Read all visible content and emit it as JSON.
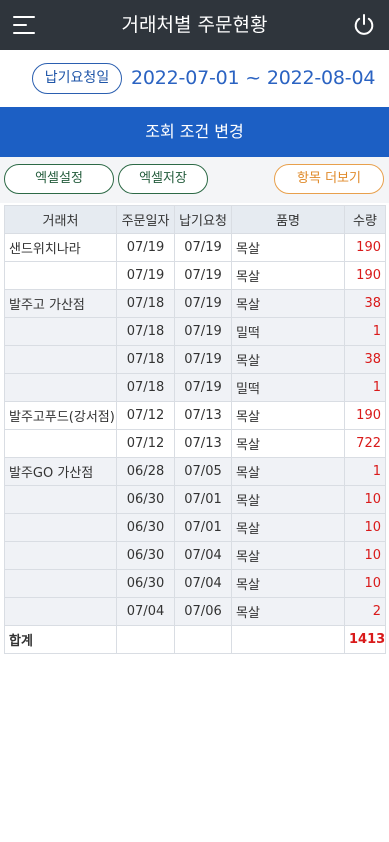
{
  "header": {
    "title": "거래처별 주문현황",
    "menu_icon": "hamburger-menu-icon",
    "power_icon": "power-icon"
  },
  "date_filter": {
    "badge_label": "납기요청일",
    "range": "2022-07-01 ~ 2022-08-04"
  },
  "search_condition_label": "조회 조건 변경",
  "buttons": {
    "excel_settings": "엑셀설정",
    "excel_save": "엑셀저장",
    "more_columns": "항목 더보기"
  },
  "table": {
    "columns": [
      "거래처",
      "주문일자",
      "납기요청",
      "품명",
      "수량"
    ],
    "rows": [
      {
        "customer": "샌드위치나라",
        "order_date": "07/19",
        "due_date": "07/19",
        "item": "목살",
        "qty": "190"
      },
      {
        "customer": "",
        "order_date": "07/19",
        "due_date": "07/19",
        "item": "목살",
        "qty": "190"
      },
      {
        "customer": "발주고 가산점",
        "order_date": "07/18",
        "due_date": "07/19",
        "item": "목살",
        "qty": "38"
      },
      {
        "customer": "",
        "order_date": "07/18",
        "due_date": "07/19",
        "item": "밀떡",
        "qty": "1"
      },
      {
        "customer": "",
        "order_date": "07/18",
        "due_date": "07/19",
        "item": "목살",
        "qty": "38"
      },
      {
        "customer": "",
        "order_date": "07/18",
        "due_date": "07/19",
        "item": "밀떡",
        "qty": "1"
      },
      {
        "customer": "발주고푸드(강서점)",
        "order_date": "07/12",
        "due_date": "07/13",
        "item": "목살",
        "qty": "190"
      },
      {
        "customer": "",
        "order_date": "07/12",
        "due_date": "07/13",
        "item": "목살",
        "qty": "722"
      },
      {
        "customer": "발주GO 가산점",
        "order_date": "06/28",
        "due_date": "07/05",
        "item": "목살",
        "qty": "1"
      },
      {
        "customer": "",
        "order_date": "06/30",
        "due_date": "07/01",
        "item": "목살",
        "qty": "10"
      },
      {
        "customer": "",
        "order_date": "06/30",
        "due_date": "07/01",
        "item": "목살",
        "qty": "10"
      },
      {
        "customer": "",
        "order_date": "06/30",
        "due_date": "07/04",
        "item": "목살",
        "qty": "10"
      },
      {
        "customer": "",
        "order_date": "06/30",
        "due_date": "07/04",
        "item": "목살",
        "qty": "10"
      },
      {
        "customer": "",
        "order_date": "07/04",
        "due_date": "07/06",
        "item": "목살",
        "qty": "2"
      }
    ],
    "total_label": "합계",
    "total_qty": "1413"
  },
  "colors": {
    "appbar": "#2f353c",
    "accent_blue": "#1c5fc4",
    "quantity_red": "#d91a1a",
    "green_outline": "#2d6a46",
    "orange_outline": "#e8a04c"
  }
}
